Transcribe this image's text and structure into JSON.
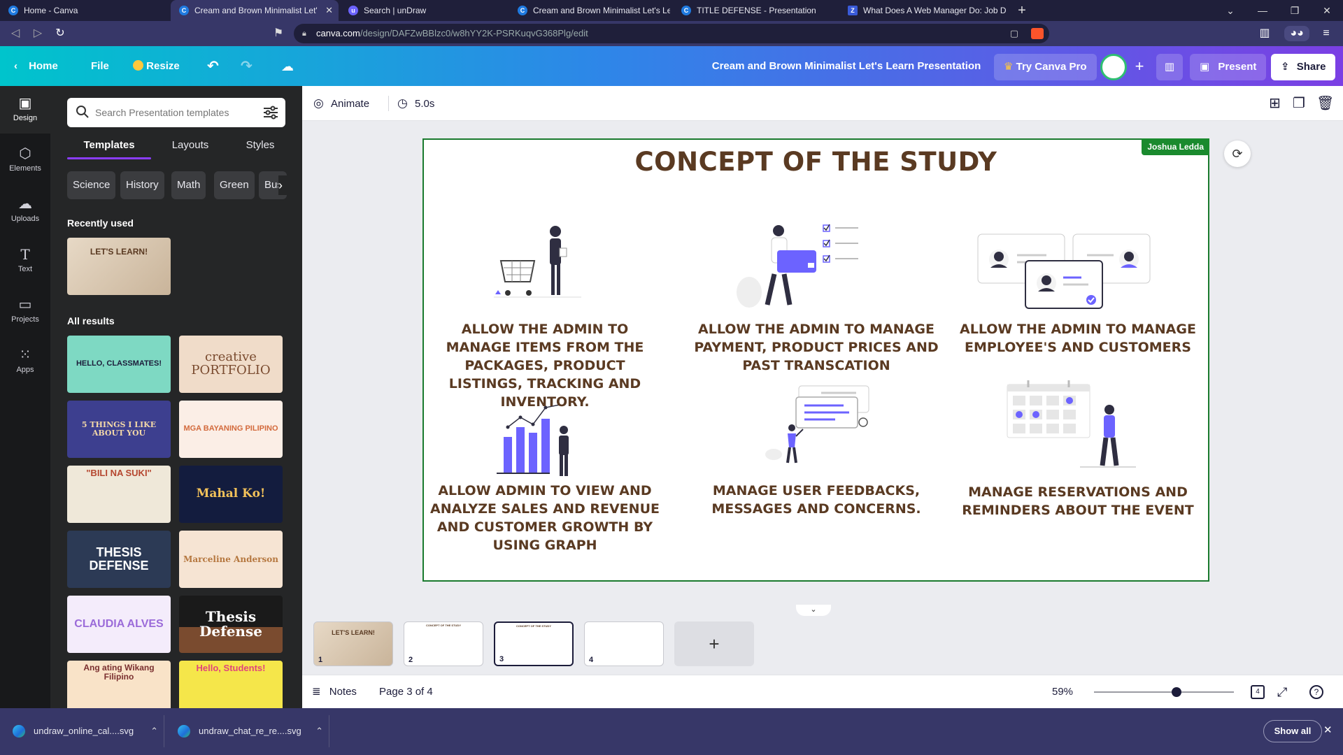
{
  "browser": {
    "tabs": [
      {
        "label": "Home - Canva",
        "icon": "canva-icon"
      },
      {
        "label": "Cream and Brown Minimalist Let'",
        "icon": "canva-icon",
        "active": true
      },
      {
        "label": "Search | unDraw",
        "icon": "undraw-icon"
      },
      {
        "label": "Cream and Brown Minimalist Let's Lea",
        "icon": "canva-icon"
      },
      {
        "label": "TITLE DEFENSE - Presentation",
        "icon": "canva-icon"
      },
      {
        "label": "What Does A Web Manager Do: Job D",
        "icon": "zippia-icon"
      }
    ],
    "url_host": "canva.com",
    "url_path": "/design/DAFZwBBlzc0/w8hYY2K-PSRKuqvG368Plg/edit"
  },
  "header": {
    "home": "Home",
    "file": "File",
    "resize": "Resize",
    "doc_title": "Cream and Brown Minimalist Let's Learn Presentation",
    "try_pro": "Try Canva Pro",
    "present": "Present",
    "share": "Share"
  },
  "rail": {
    "items": [
      {
        "label": "Design",
        "icon": "design-icon"
      },
      {
        "label": "Elements",
        "icon": "elements-icon"
      },
      {
        "label": "Uploads",
        "icon": "uploads-icon"
      },
      {
        "label": "Text",
        "icon": "text-icon"
      },
      {
        "label": "Projects",
        "icon": "folder-icon"
      },
      {
        "label": "Apps",
        "icon": "apps-icon"
      }
    ]
  },
  "panel": {
    "search_placeholder": "Search Presentation templates",
    "tabs": [
      "Templates",
      "Layouts",
      "Styles"
    ],
    "chips": [
      "Science",
      "History",
      "Math",
      "Green",
      "Bus"
    ],
    "recently_used": "Recently used",
    "recent_thumb": "LET'S LEARN!",
    "all_results": "All results",
    "templates": [
      "HELLO, CLASSMATES!",
      "creative PORTFOLIO",
      "5 THINGS I LIKE ABOUT YOU",
      "MGA BAYANING PILIPINO",
      "\"BILI NA SUKI\"",
      "Mahal Ko!",
      "THESIS DEFENSE",
      "Marceline Anderson",
      "CLAUDIA ALVES",
      "Thesis Defense",
      "Ang ating Wikang Filipino",
      "Hello, Students!"
    ]
  },
  "toolbar": {
    "animate": "Animate",
    "duration": "5.0s"
  },
  "slide": {
    "title": "CONCEPT OF THE STUDY",
    "collaborator": "Joshua Ledda",
    "captions": [
      "ALLOW THE ADMIN TO MANAGE ITEMS FROM THE  PACKAGES, PRODUCT LISTINGS, TRACKING AND INVENTORY.",
      "ALLOW THE ADMIN TO MANAGE PAYMENT, PRODUCT PRICES AND PAST TRANSCATION",
      "ALLOW THE ADMIN TO MANAGE EMPLOYEE'S AND CUSTOMERS",
      "ALLOW ADMIN TO VIEW AND ANALYZE SALES AND REVENUE AND CUSTOMER GROWTH BY USING GRAPH",
      "MANAGE USER FEEDBACKS, MESSAGES AND CONCERNS.",
      "MANAGE RESERVATIONS AND REMINDERS ABOUT THE EVENT"
    ]
  },
  "pages": {
    "thumbs": [
      {
        "num": "1",
        "label": "LET'S LEARN!"
      },
      {
        "num": "2",
        "label": "CONCEPT OF THE STUDY"
      },
      {
        "num": "3",
        "label": "CONCEPT OF THE STUDY"
      },
      {
        "num": "4",
        "label": ""
      }
    ],
    "add": "+"
  },
  "footer": {
    "notes": "Notes",
    "page_indicator": "Page 3 of 4",
    "zoom": "59%",
    "zoom_level": 0.59,
    "pages_count": "4"
  },
  "downloads": {
    "items": [
      "undraw_online_cal....svg",
      "undraw_chat_re_re....svg"
    ],
    "show_all": "Show all"
  },
  "colors": {
    "accent": "#8b3dff",
    "title_brown": "#5a3a22",
    "illus_purple": "#6c63ff",
    "slide_border": "#1a7a2e"
  }
}
